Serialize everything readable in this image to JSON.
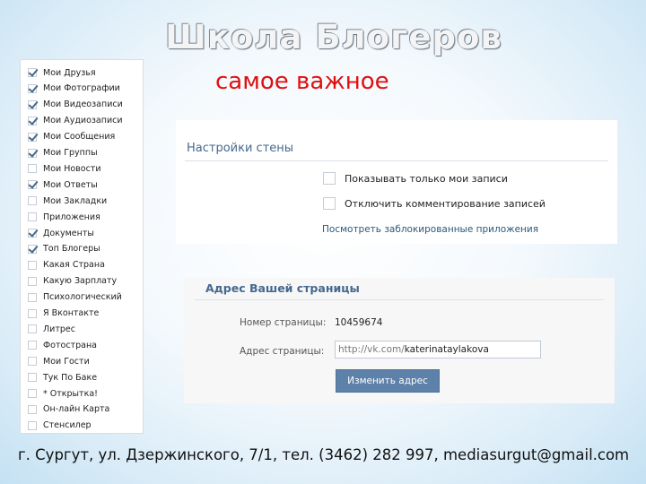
{
  "slide": {
    "title": "Школа Блогеров",
    "subtitle": "самое важное",
    "footer": "г. Сургут, ул. Дзержинского, 7/1, тел. (3462) 282 997, mediasurgut@gmail.com"
  },
  "menu": {
    "items": [
      {
        "label": "Мои Друзья",
        "checked": true
      },
      {
        "label": "Мои Фотографии",
        "checked": true
      },
      {
        "label": "Мои Видеозаписи",
        "checked": true
      },
      {
        "label": "Мои Аудиозаписи",
        "checked": true
      },
      {
        "label": "Мои Сообщения",
        "checked": true
      },
      {
        "label": "Мои Группы",
        "checked": true
      },
      {
        "label": "Мои Новости",
        "checked": false
      },
      {
        "label": "Мои Ответы",
        "checked": true
      },
      {
        "label": "Мои Закладки",
        "checked": false
      },
      {
        "label": "Приложения",
        "checked": false
      },
      {
        "label": "Документы",
        "checked": true
      },
      {
        "label": "Топ Блогеры",
        "checked": true
      },
      {
        "label": "Какая Страна",
        "checked": false
      },
      {
        "label": "Какую Зарплату",
        "checked": false
      },
      {
        "label": "Психологический",
        "checked": false
      },
      {
        "label": "Я Вконтакте",
        "checked": false
      },
      {
        "label": "Литрес",
        "checked": false
      },
      {
        "label": "Фотострана",
        "checked": false
      },
      {
        "label": "Мои Гости",
        "checked": false
      },
      {
        "label": "Тук По Баке",
        "checked": false
      },
      {
        "label": "* Открытка!",
        "checked": false
      },
      {
        "label": "Он-лайн Карта",
        "checked": false
      },
      {
        "label": "Стенсилер",
        "checked": false
      }
    ]
  },
  "wall": {
    "heading": "Настройки стены",
    "options": [
      {
        "label": "Показывать только мои записи",
        "checked": false
      },
      {
        "label": "Отключить комментирование записей",
        "checked": false
      }
    ],
    "link": "Посмотреть заблокированные приложения"
  },
  "address": {
    "heading": "Адрес Вашей страницы",
    "number_label": "Номер страницы:",
    "number_value": "10459674",
    "address_label": "Адрес страницы:",
    "url_prefix": "http://vk.com/",
    "url_value": "katerinataylakova",
    "button_label": "Изменить адрес"
  },
  "colors": {
    "link": "#2b587a",
    "heading": "#45688e",
    "button": "#5d81a8",
    "subtitle": "#e01010"
  }
}
